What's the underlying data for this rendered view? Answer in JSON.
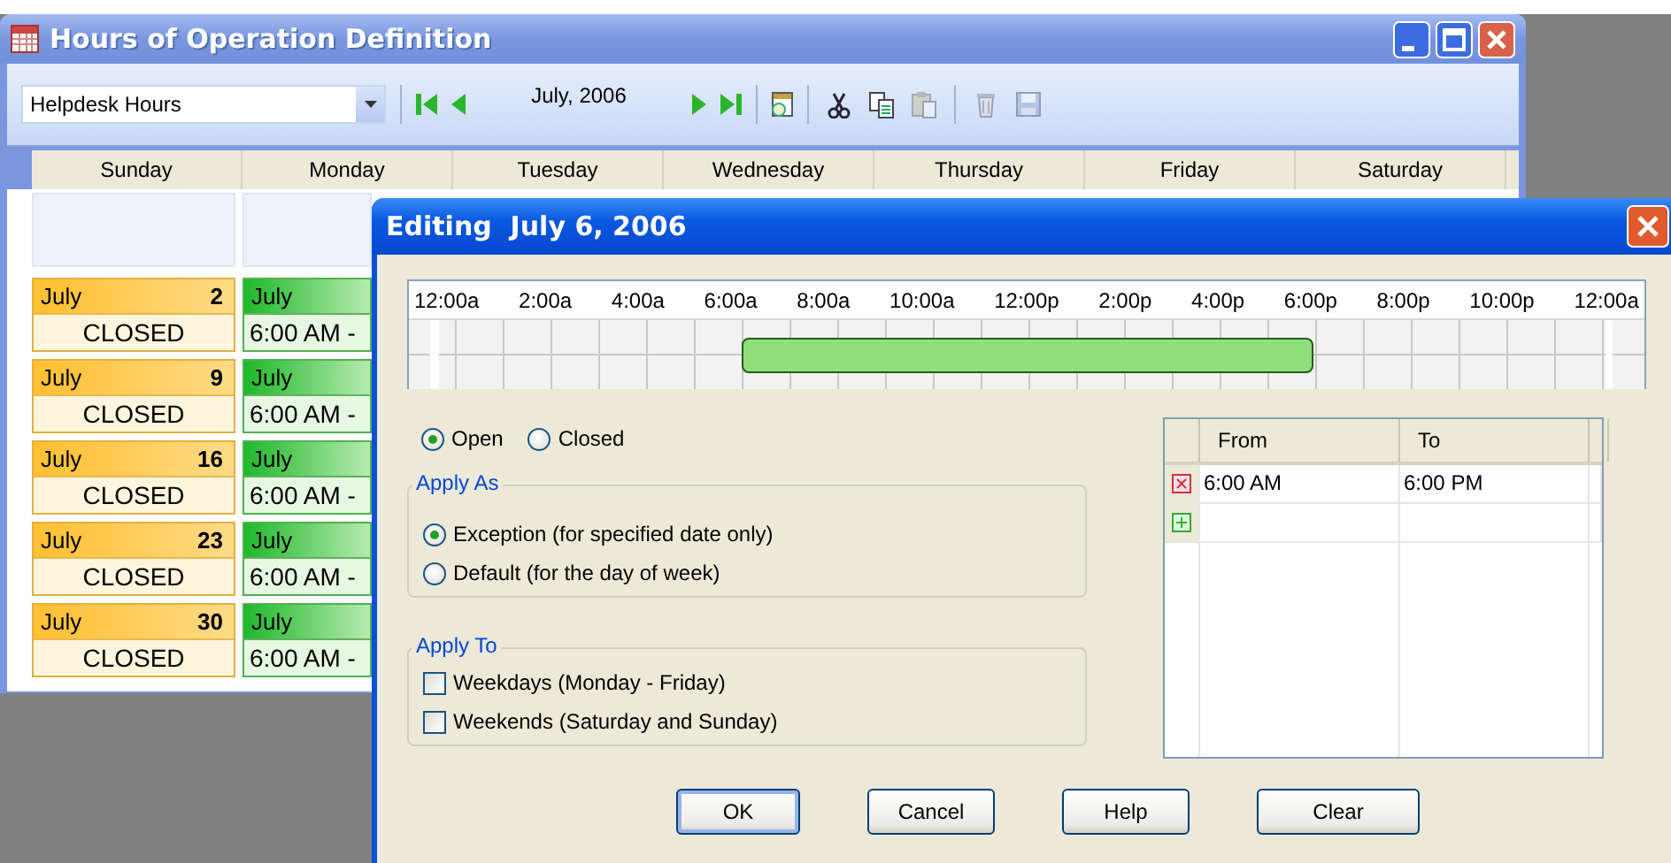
{
  "main_window": {
    "title": "Hours of Operation Definition",
    "schedule_select": {
      "value": "Helpdesk Hours"
    },
    "month_label": "July, 2006",
    "toolbar_buttons": [
      {
        "kind": "cut",
        "disabled": false
      },
      {
        "kind": "copy",
        "disabled": false
      },
      {
        "kind": "paste",
        "disabled": true
      },
      {
        "kind": "delete",
        "disabled": true
      },
      {
        "kind": "save",
        "disabled": true
      }
    ],
    "days": [
      "Sunday",
      "Monday",
      "Tuesday",
      "Wednesday",
      "Thursday",
      "Friday",
      "Saturday"
    ],
    "weeks": [
      {
        "cells": [
          {
            "kind": "empty"
          },
          {
            "kind": "empty"
          }
        ]
      },
      {
        "cells": [
          {
            "kind": "closed",
            "month": "July",
            "day": "2",
            "text": "CLOSED"
          },
          {
            "kind": "open",
            "month": "July",
            "text": "6:00 AM -"
          }
        ]
      },
      {
        "cells": [
          {
            "kind": "closed",
            "month": "July",
            "day": "9",
            "text": "CLOSED"
          },
          {
            "kind": "open",
            "month": "July",
            "text": "6:00 AM -"
          }
        ]
      },
      {
        "cells": [
          {
            "kind": "closed",
            "month": "July",
            "day": "16",
            "text": "CLOSED"
          },
          {
            "kind": "open",
            "month": "July",
            "text": "6:00 AM -"
          }
        ]
      },
      {
        "cells": [
          {
            "kind": "closed",
            "month": "July",
            "day": "23",
            "text": "CLOSED"
          },
          {
            "kind": "open",
            "month": "July",
            "text": "6:00 AM -"
          }
        ]
      },
      {
        "cells": [
          {
            "kind": "closed",
            "month": "July",
            "day": "30",
            "text": "CLOSED"
          },
          {
            "kind": "open",
            "month": "July",
            "text": "6:00 AM -"
          }
        ]
      }
    ]
  },
  "dialog": {
    "title": "Editing  July 6, 2006",
    "timeline": {
      "labels": [
        "12:00a",
        "2:00a",
        "4:00a",
        "6:00a",
        "8:00a",
        "10:00a",
        "12:00p",
        "2:00p",
        "4:00p",
        "6:00p",
        "8:00p",
        "10:00p",
        "12:00a"
      ]
    },
    "status_options": [
      {
        "label": "Open",
        "selected": true
      },
      {
        "label": "Closed",
        "selected": false
      }
    ],
    "apply_as": {
      "title": "Apply As",
      "options": [
        {
          "label": "Exception (for specified date only)",
          "selected": true
        },
        {
          "label": "Default (for the day of week)",
          "selected": false
        }
      ]
    },
    "apply_to": {
      "title": "Apply To",
      "options": [
        {
          "label": "Weekdays (Monday - Friday)",
          "checked": false
        },
        {
          "label": "Weekends (Saturday and Sunday)",
          "checked": false
        }
      ]
    },
    "hours_table": {
      "columns": [
        "From",
        "To"
      ],
      "rows": [
        {
          "kind": "entry",
          "from": "6:00 AM",
          "to": "6:00 PM"
        },
        {
          "kind": "new"
        }
      ]
    },
    "buttons": [
      {
        "label": "OK",
        "default": true
      },
      {
        "label": "Cancel",
        "default": false
      },
      {
        "label": "Help",
        "default": false
      },
      {
        "label": "Clear",
        "default": false
      }
    ]
  }
}
